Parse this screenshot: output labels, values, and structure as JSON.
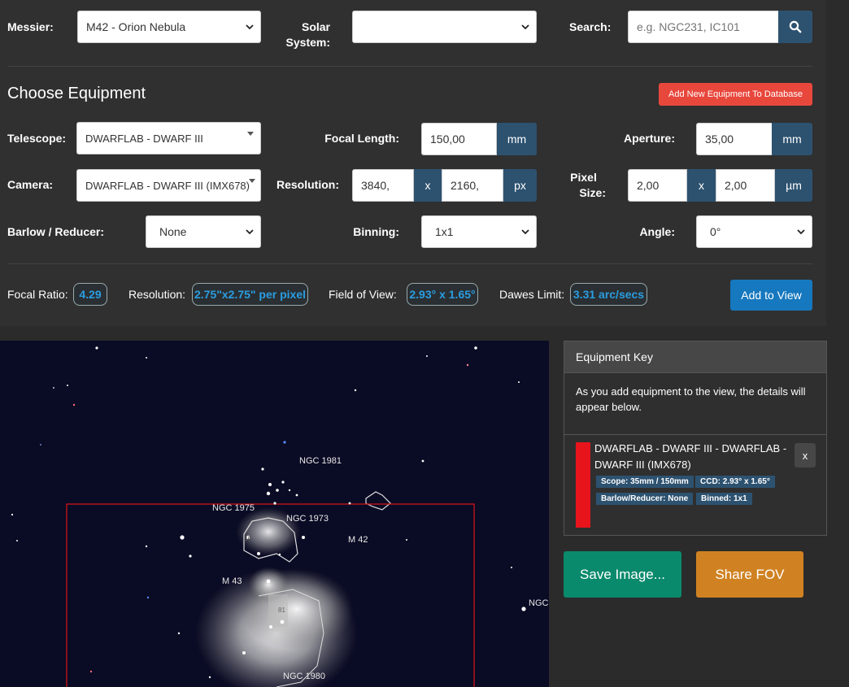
{
  "messier": {
    "label": "Messier:",
    "value": "M42 - Orion Nebula"
  },
  "solar_system": {
    "label_line1": "Solar",
    "label_line2": "System:",
    "value": ""
  },
  "search": {
    "label": "Search:",
    "placeholder": "e.g. NGC231, IC101",
    "icon": "search-icon"
  },
  "equipment": {
    "heading": "Choose Equipment",
    "add_db_button": "Add New Equipment To Database",
    "telescope": {
      "label": "Telescope:",
      "value": "DWARFLAB - DWARF III"
    },
    "focal_length": {
      "label": "Focal Length:",
      "value": "150,00",
      "unit": "mm"
    },
    "aperture": {
      "label": "Aperture:",
      "value": "35,00",
      "unit": "mm"
    },
    "camera": {
      "label": "Camera:",
      "value": "DWARFLAB - DWARF III (IMX678)"
    },
    "resolution": {
      "label": "Resolution:",
      "x": "3840,",
      "sep": "x",
      "y": "2160,",
      "unit": "px"
    },
    "pixel_size": {
      "label_line1": "Pixel",
      "label_line2": "Size:",
      "x": "2,00",
      "sep": "x",
      "y": "2,00",
      "unit": "µm"
    },
    "barlow": {
      "label": "Barlow / Reducer:",
      "value": "None"
    },
    "binning": {
      "label": "Binning:",
      "value": "1x1"
    },
    "angle": {
      "label": "Angle:",
      "value": "0°"
    }
  },
  "stats": {
    "focal_ratio": {
      "label": "Focal Ratio:",
      "value": "4.29"
    },
    "resolution": {
      "label": "Resolution:",
      "value": "2.75\"x2.75\" per pixel"
    },
    "fov": {
      "label": "Field of View:",
      "value": "2.93° x 1.65°"
    },
    "dawes": {
      "label": "Dawes Limit:",
      "value": "3.31 arc/secs"
    },
    "add_to_view": "Add to View"
  },
  "sky": {
    "labels": {
      "ngc1981": "NGC 1981",
      "ngc1975": "NGC 1975",
      "ngc1973": "NGC 1973",
      "m42": "M 42",
      "m43": "M 43",
      "ngc_edge": "NGC",
      "ngc1980": "NGC 1980",
      "n45": "45",
      "n81": "81"
    }
  },
  "equipment_key": {
    "title": "Equipment Key",
    "description": "As you add equipment to the view, the details will appear below.",
    "entry": {
      "color": "#e8141c",
      "name": "DWARFLAB - DWARF III - DWARFLAB - DWARF III (IMX678)",
      "remove": "x",
      "tags": [
        "Scope: 35mm / 150mm",
        "CCD: 2.93° x 1.65°",
        "Barlow/Reducer: None",
        "Binned: 1x1"
      ]
    }
  },
  "actions": {
    "save_image": "Save Image...",
    "share_fov": "Share FOV"
  },
  "colors": {
    "accent_blue": "#2a9de0",
    "addon": "#2d5270",
    "danger": "#e8473c",
    "save": "#0a8a6c",
    "share": "#d08222"
  }
}
